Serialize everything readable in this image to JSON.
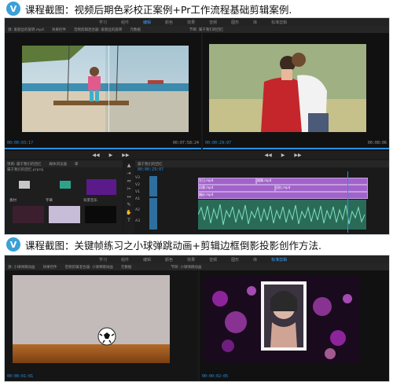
{
  "section1": {
    "badge": "V",
    "title": "课程截图：视频后期色彩校正案例+Pr工作流程基础剪辑案例.",
    "menu": [
      "学习",
      "组件",
      "编辑",
      "颜色",
      "效果",
      "音频",
      "图形",
      "库",
      "标准剪辑"
    ],
    "active_menu": "编辑",
    "source_tabs": [
      "源: 爱丽丝的旋转.mp4",
      "效果控件",
      "音频剪辑混合器: 爱丽丝的旋转",
      "元数据"
    ],
    "program_tab": "节目: 属于我们的回忆",
    "source_time_start": "00:00:03:17",
    "source_time_end": "00:07:58:24",
    "program_time_start": "00:00:29:07",
    "program_time_end": "00:08:06",
    "project_tabs": [
      "项目: 属于我们的回忆",
      "媒体浏览器",
      "库",
      "信息"
    ],
    "project_file": "属于我们的回忆.prproj",
    "timeline_tab": "属于我们的回忆",
    "timeline_time": "00:00:29:07",
    "bins": [
      "素材",
      "字幕",
      "背景音乐"
    ],
    "track_names": [
      "V3",
      "V2",
      "V1",
      "A1",
      "A2",
      "A3"
    ],
    "clip_labels": [
      "生日.mp4",
      "跳舞.mp4",
      "风景.mp4",
      "回忆.mp4",
      "婚纱.mp4"
    ]
  },
  "section2": {
    "badge": "V",
    "title": "课程截图：关键帧练习之小球弹跳动画+剪辑边框倒影投影创作方法.",
    "menu": [
      "学习",
      "组件",
      "编辑",
      "颜色",
      "效果",
      "音频",
      "图形",
      "库",
      "标准剪辑"
    ],
    "active_menu": "标准剪辑",
    "source_tabs": [
      "源: 小球弹跳动画",
      "效果控件",
      "音频剪辑混合器: 小球弹跳动画",
      "元数据"
    ],
    "program_tab": "节目: 小球弹跳动画",
    "source_time_start": "00:00:01:01",
    "program_time_start": "00:00:02:05"
  },
  "colors": {
    "accent": "#2d8fe0",
    "clip": "#a064c8",
    "audio": "#2a6b58",
    "badge": "#3aa0d8"
  },
  "icons": [
    "v-badge-icon",
    "play-icon",
    "step-back-icon",
    "step-forward-icon",
    "folder-icon",
    "selection-tool-icon",
    "razor-tool-icon",
    "hand-tool-icon",
    "text-tool-icon"
  ]
}
